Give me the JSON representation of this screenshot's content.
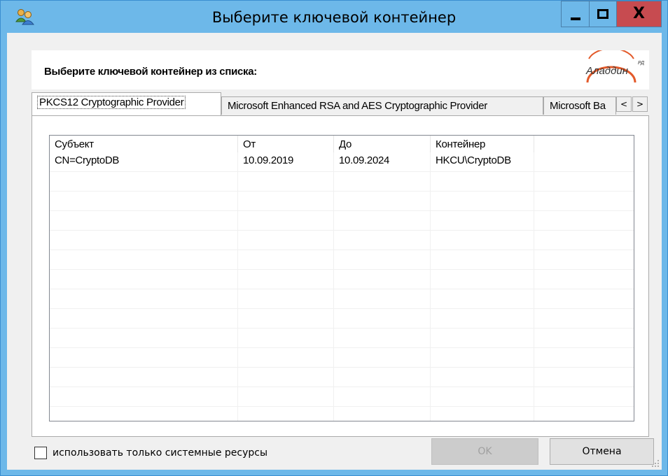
{
  "window": {
    "title": "Выберите ключевой контейнер",
    "minimize_label": "—",
    "maximize_label": "☐",
    "close_label": "X",
    "colors": {
      "titlebar": "#6db8e9",
      "close": "#c74b50",
      "logo_arc": "#e35a2a"
    }
  },
  "header": {
    "label": "Выберите ключевой контейнер из списка:",
    "logo_text": "Аладдин",
    "logo_suffix": "РД"
  },
  "tabs": [
    {
      "label": "PKCS12 Cryptographic Provider",
      "active": true
    },
    {
      "label": "Microsoft Enhanced RSA and AES Cryptographic Provider",
      "active": false
    },
    {
      "label": "Microsoft Ba",
      "active": false
    }
  ],
  "tab_scroll": {
    "left": "<",
    "right": ">"
  },
  "table": {
    "columns": [
      "Субъект",
      "От",
      "До",
      "Контейнер"
    ],
    "rows": [
      [
        "CN=CryptoDB",
        "10.09.2019",
        "10.09.2024",
        "HKCU\\CryptoDB"
      ]
    ]
  },
  "footer": {
    "checkbox_label": "использовать только системные ресурсы",
    "checkbox_checked": false,
    "ok_label": "OK",
    "ok_enabled": false,
    "cancel_label": "Отмена"
  }
}
